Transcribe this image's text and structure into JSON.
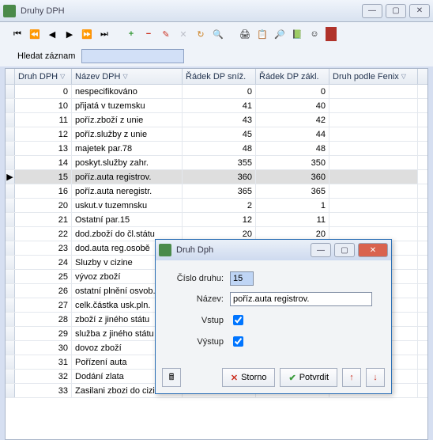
{
  "window": {
    "title": "Druhy DPH"
  },
  "search": {
    "label": "Hledat záznam",
    "value": ""
  },
  "columns": [
    "Druh DPH",
    "Název DPH",
    "Řádek DP sníž.",
    "Řádek DP zákl.",
    "Druh podle Fenix"
  ],
  "rows": [
    {
      "druh": "0",
      "nazev": "nespecifikováno",
      "sniz": "0",
      "zakl": "0"
    },
    {
      "druh": "10",
      "nazev": "přijatá v tuzemsku",
      "sniz": "41",
      "zakl": "40"
    },
    {
      "druh": "11",
      "nazev": "poříz.zboží z unie",
      "sniz": "43",
      "zakl": "42"
    },
    {
      "druh": "12",
      "nazev": "poříz.služby z unie",
      "sniz": "45",
      "zakl": "44"
    },
    {
      "druh": "13",
      "nazev": "majetek par.78",
      "sniz": "48",
      "zakl": "48"
    },
    {
      "druh": "14",
      "nazev": "poskyt.služby zahr.",
      "sniz": "355",
      "zakl": "350"
    },
    {
      "druh": "15",
      "nazev": "poříz.auta registrov.",
      "sniz": "360",
      "zakl": "360",
      "sel": true
    },
    {
      "druh": "16",
      "nazev": "poříz.auta neregistr.",
      "sniz": "365",
      "zakl": "365"
    },
    {
      "druh": "20",
      "nazev": "uskut.v tuzemnsku",
      "sniz": "2",
      "zakl": "1"
    },
    {
      "druh": "21",
      "nazev": "Ostatní  par.15",
      "sniz": "12",
      "zakl": "11"
    },
    {
      "druh": "22",
      "nazev": "dod.zboží do čl.státu",
      "sniz": "20",
      "zakl": "20"
    },
    {
      "druh": "23",
      "nazev": "dod.auta reg.osobě",
      "sniz": "",
      "zakl": ""
    },
    {
      "druh": "24",
      "nazev": "Sluzby v cizine",
      "sniz": "",
      "zakl": ""
    },
    {
      "druh": "25",
      "nazev": "vývoz zboží",
      "sniz": "",
      "zakl": ""
    },
    {
      "druh": "26",
      "nazev": "ostatní plnění osvob.",
      "sniz": "",
      "zakl": ""
    },
    {
      "druh": "27",
      "nazev": "celk.částka usk.pln.",
      "sniz": "",
      "zakl": ""
    },
    {
      "druh": "28",
      "nazev": "zboží z jiného státu",
      "sniz": "",
      "zakl": ""
    },
    {
      "druh": "29",
      "nazev": "služba z jiného státu",
      "sniz": "",
      "zakl": ""
    },
    {
      "druh": "30",
      "nazev": "dovoz zboží",
      "sniz": "",
      "zakl": ""
    },
    {
      "druh": "31",
      "nazev": "Pořízení auta",
      "sniz": "",
      "zakl": ""
    },
    {
      "druh": "32",
      "nazev": "Dodání zlata",
      "sniz": "",
      "zakl": ""
    },
    {
      "druh": "33",
      "nazev": "Zasilani zbozi do cizin",
      "sniz": "",
      "zakl": ""
    }
  ],
  "dialog": {
    "title": "Druh Dph",
    "fields": {
      "cislo_label": "Číslo druhu:",
      "cislo_value": "15",
      "nazev_label": "Název:",
      "nazev_value": "poříz.auta registrov.",
      "vstup_label": "Vstup",
      "vstup_checked": true,
      "vystup_label": "Výstup",
      "vystup_checked": true
    },
    "buttons": {
      "storno": "Storno",
      "potvrdit": "Potvrdit"
    }
  }
}
